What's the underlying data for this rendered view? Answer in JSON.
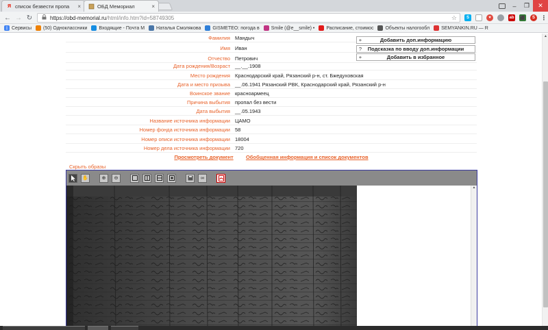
{
  "browser": {
    "tabs": [
      {
        "title": "список безвести пропа",
        "active": false,
        "favicon": "yandex-icon"
      },
      {
        "title": "ОБД Мемориал",
        "active": true,
        "favicon": "memorial-icon"
      }
    ],
    "url_host": "https://obd-memorial.ru",
    "url_path": "/html/info.htm?id=58749305",
    "bookmarks": [
      {
        "label": "Сервисы",
        "icon": "apps-icon",
        "color": "#4285f4"
      },
      {
        "label": "(50) Одноклассники",
        "icon": "ok-icon",
        "color": "#ee8208"
      },
      {
        "label": "Входящие - Почта М",
        "icon": "mail-icon",
        "color": "#168de2"
      },
      {
        "label": "Наталья Смолякова",
        "icon": "vk-icon",
        "color": "#4a76a8"
      },
      {
        "label": "GISMETEO: погода в",
        "icon": "gismeteo-icon",
        "color": "#2f7fd8"
      },
      {
        "label": "Smile (@e__smile) •",
        "icon": "instagram-icon",
        "color": "#c13584"
      },
      {
        "label": "Расписание, стоимос",
        "icon": "rzd-icon",
        "color": "#e21a1a"
      },
      {
        "label": "Объекты налогообл",
        "icon": "nalog-icon",
        "color": "#555555"
      },
      {
        "label": "SEMYANKIN.RU — R",
        "icon": "semyankin-icon",
        "color": "#d33"
      }
    ]
  },
  "person": {
    "fields": [
      {
        "label": "Фамилия",
        "value": "Мандыч"
      },
      {
        "label": "Имя",
        "value": "Иван"
      },
      {
        "label": "Отчество",
        "value": "Петрович"
      },
      {
        "label": "Дата рождения/Возраст",
        "value": "__.__.1908"
      },
      {
        "label": "Место рождения",
        "value": "Краснодарский край, Рязанский р-н, ст. Бжедуховская"
      },
      {
        "label": "Дата и место призыва",
        "value": "__.06.1941 Рязанский РВК, Краснодарский край, Рязанский р-н"
      },
      {
        "label": "Воинское звание",
        "value": "красноармеец"
      },
      {
        "label": "Причина выбытия",
        "value": "пропал без вести"
      },
      {
        "label": "Дата выбытия",
        "value": "__.05.1943"
      },
      {
        "label": "Название источника информации",
        "value": "ЦАМО"
      },
      {
        "label": "Номер фонда источника информации",
        "value": "58"
      },
      {
        "label": "Номер описи источника информации",
        "value": "18004"
      },
      {
        "label": "Номер дела источника информации",
        "value": "720"
      }
    ]
  },
  "actions": {
    "add_info": "Добавить доп.информацию",
    "hint": "Подсказка по вводу доп.информации",
    "add_fav": "Добавить в избранное",
    "plus_symbol": "+",
    "question_symbol": "?"
  },
  "links": {
    "view_document": "Просмотреть документ",
    "summary": "Обобщенная информация и список документов",
    "hide_images": "Скрыть образы"
  },
  "colors": {
    "label": "#e8622a",
    "link": "#e8622a",
    "viewer_border": "#3a3aa0",
    "viewer_toolbar": "#8a8a8a"
  }
}
